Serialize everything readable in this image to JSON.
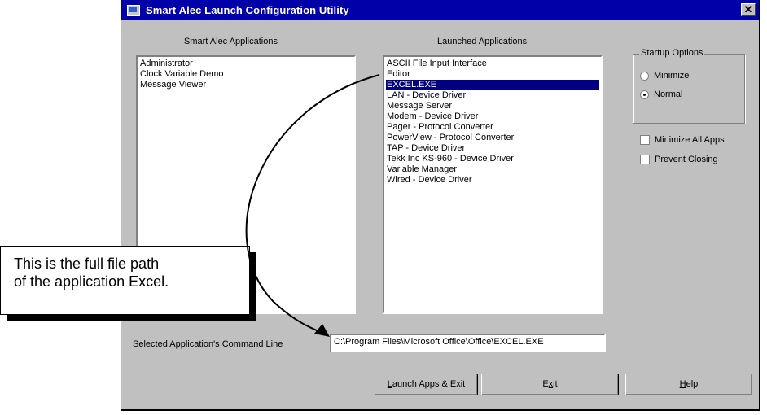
{
  "window": {
    "title": "Smart Alec Launch Configuration Utility",
    "close_symbol": "✕"
  },
  "smart_alec_apps": {
    "label": "Smart Alec Applications",
    "items": [
      "Administrator",
      "Clock Variable Demo",
      "Message Viewer"
    ]
  },
  "launched_apps": {
    "label": "Launched Applications",
    "items": [
      "ASCII File Input Interface",
      "Editor",
      "EXCEL.EXE",
      "LAN - Device Driver",
      "Message Server",
      "Modem - Device Driver",
      "Pager - Protocol Converter",
      "PowerView - Protocol Converter",
      "TAP - Device Driver",
      "Tekk Inc KS-960 - Device Driver",
      "Variable Manager",
      "Wired - Device Driver"
    ],
    "selected": "EXCEL.EXE"
  },
  "startup_options": {
    "title": "Startup Options",
    "minimize_label": "Minimize",
    "normal_label": "Normal",
    "selected": "Normal"
  },
  "checkboxes": {
    "minimize_all_label": "Minimize All Apps",
    "prevent_closing_label": "Prevent Closing"
  },
  "command_line": {
    "label": "Selected Application's Command Line",
    "value": "C:\\Program Files\\Microsoft Office\\Office\\EXCEL.EXE"
  },
  "buttons": {
    "launch_prefix": "L",
    "launch_rest": "aunch Apps & Exit",
    "exit_prefix": "E",
    "exit_underline": "x",
    "exit_rest": "it",
    "help_underline": "H",
    "help_rest": "elp"
  },
  "callout": {
    "line1": "This is the full file path",
    "line2": "of the application Excel."
  },
  "colors": {
    "titlebar": "#0000a8",
    "selection": "#000080",
    "face": "#c0c0c0"
  },
  "icons": [
    "app-window-icon",
    "close-icon",
    "arrow-pointer"
  ]
}
